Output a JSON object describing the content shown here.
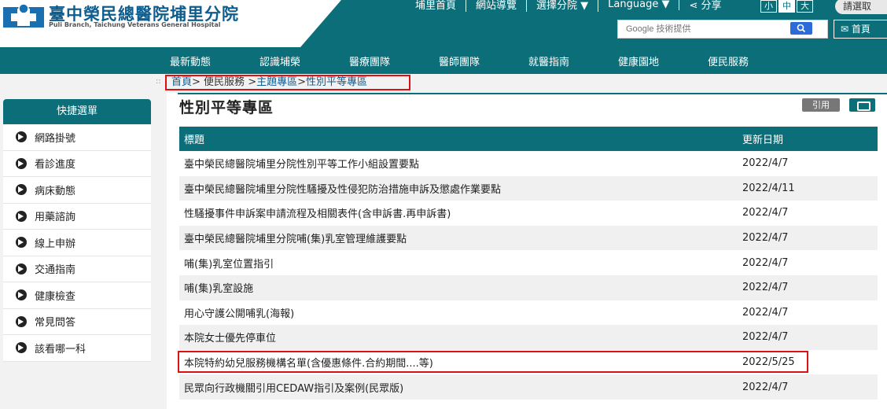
{
  "header": {
    "hospital_name": "臺中榮民總醫院埔里分院",
    "hospital_name_en": "Puli Branch, Taichung Veterans General Hospital",
    "top_links": [
      "埔里首頁",
      "網站導覽",
      "選擇分院 ▼",
      "Language ▼",
      "分享"
    ],
    "font_sizes": [
      "小",
      "中",
      "大"
    ],
    "login_label": "請選取",
    "search_placeholder": "Google 技術提供",
    "mail_label": "首頁"
  },
  "nav": {
    "items": [
      "最新動態",
      "認識埔榮",
      "醫療團隊",
      "醫師團隊",
      "就醫指南",
      "健康園地",
      "便民服務"
    ]
  },
  "breadcrumb": {
    "home": "首頁",
    "sep1": "> ",
    "l1": "便民服務",
    "sep2": " >",
    "l2": "主題專區",
    "sep3": ">",
    "l3": "性別平等專區"
  },
  "sidebar": {
    "title": "快捷選單",
    "items": [
      "網路掛號",
      "看診進度",
      "病床動態",
      "用藥諮詢",
      "線上申辦",
      "交通指南",
      "健康檢查",
      "常見問答",
      "該看哪一科"
    ]
  },
  "main": {
    "title": "性別平等專區",
    "cite_label": "引用",
    "columns": [
      "標題",
      "更新日期"
    ],
    "rows": [
      [
        "臺中榮民總醫院埔里分院性別平等工作小組設置要點",
        "2022/4/7"
      ],
      [
        "臺中榮民總醫院埔里分院性騷擾及性侵犯防治措施申訴及懲處作業要點",
        "2022/4/11"
      ],
      [
        "性騷擾事件申訴案申請流程及相關表件(含申訴書.再申訴書)",
        "2022/4/7"
      ],
      [
        "臺中榮民總醫院埔里分院哺(集)乳室管理維護要點",
        "2022/4/7"
      ],
      [
        "哺(集)乳室位置指引",
        "2022/4/7"
      ],
      [
        "哺(集)乳室設施",
        "2022/4/7"
      ],
      [
        "用心守護公開哺乳(海報)",
        "2022/4/7"
      ],
      [
        "本院女士優先停車位",
        "2022/4/7"
      ],
      [
        "本院特約幼兒服務機構名單(含優惠條件.合約期間....等)",
        "2022/5/25"
      ],
      [
        "民眾向行政機關引用CEDAW指引及案例(民眾版)",
        "2022/4/7"
      ]
    ]
  },
  "colors": {
    "teal": "#0b6e79",
    "highlight": "#d11111"
  }
}
